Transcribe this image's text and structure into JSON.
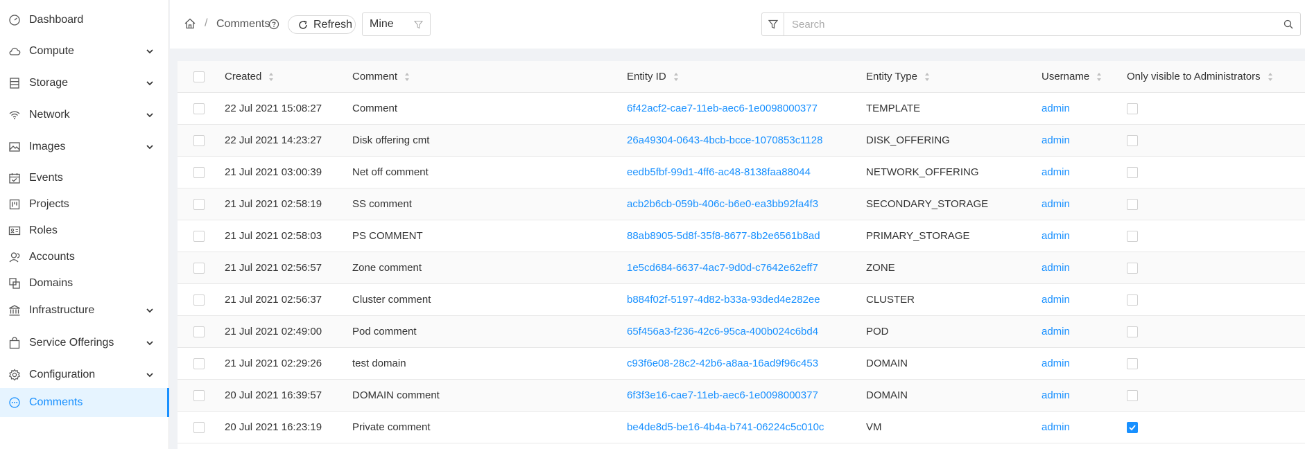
{
  "sidebar": {
    "items": [
      {
        "label": "Dashboard",
        "icon": "dashboard-icon",
        "expandable": false
      },
      {
        "label": "Compute",
        "icon": "cloud-icon",
        "expandable": true
      },
      {
        "label": "Storage",
        "icon": "storage-icon",
        "expandable": true
      },
      {
        "label": "Network",
        "icon": "wifi-icon",
        "expandable": true
      },
      {
        "label": "Images",
        "icon": "picture-icon",
        "expandable": true
      },
      {
        "label": "Events",
        "icon": "schedule-icon",
        "expandable": false
      },
      {
        "label": "Projects",
        "icon": "project-icon",
        "expandable": false
      },
      {
        "label": "Roles",
        "icon": "idcard-icon",
        "expandable": false
      },
      {
        "label": "Accounts",
        "icon": "team-icon",
        "expandable": false
      },
      {
        "label": "Domains",
        "icon": "block-icon",
        "expandable": false
      },
      {
        "label": "Infrastructure",
        "icon": "bank-icon",
        "expandable": true
      },
      {
        "label": "Service Offerings",
        "icon": "shopping-icon",
        "expandable": true
      },
      {
        "label": "Configuration",
        "icon": "setting-icon",
        "expandable": true
      },
      {
        "label": "Comments",
        "icon": "message-icon",
        "expandable": false,
        "active": true
      }
    ]
  },
  "toolbar": {
    "breadcrumb_separator": "/",
    "title": "Comments",
    "refresh_label": "Refresh",
    "filter_value": "Mine",
    "search_placeholder": "Search"
  },
  "table": {
    "columns": [
      "Created",
      "Comment",
      "Entity ID",
      "Entity Type",
      "Username",
      "Only visible to Administrators"
    ],
    "rows": [
      {
        "created": "22 Jul 2021 15:08:27",
        "comment": "Comment",
        "entity_id": "6f42acf2-cae7-11eb-aec6-1e0098000377",
        "entity_type": "TEMPLATE",
        "username": "admin",
        "admin_only": false
      },
      {
        "created": "22 Jul 2021 14:23:27",
        "comment": "Disk offering cmt",
        "entity_id": "26a49304-0643-4bcb-bcce-1070853c1128",
        "entity_type": "DISK_OFFERING",
        "username": "admin",
        "admin_only": false
      },
      {
        "created": "21 Jul 2021 03:00:39",
        "comment": "Net off comment",
        "entity_id": "eedb5fbf-99d1-4ff6-ac48-8138faa88044",
        "entity_type": "NETWORK_OFFERING",
        "username": "admin",
        "admin_only": false
      },
      {
        "created": "21 Jul 2021 02:58:19",
        "comment": "SS comment",
        "entity_id": "acb2b6cb-059b-406c-b6e0-ea3bb92fa4f3",
        "entity_type": "SECONDARY_STORAGE",
        "username": "admin",
        "admin_only": false
      },
      {
        "created": "21 Jul 2021 02:58:03",
        "comment": "PS COMMENT",
        "entity_id": "88ab8905-5d8f-35f8-8677-8b2e6561b8ad",
        "entity_type": "PRIMARY_STORAGE",
        "username": "admin",
        "admin_only": false
      },
      {
        "created": "21 Jul 2021 02:56:57",
        "comment": "Zone comment",
        "entity_id": "1e5cd684-6637-4ac7-9d0d-c7642e62eff7",
        "entity_type": "ZONE",
        "username": "admin",
        "admin_only": false
      },
      {
        "created": "21 Jul 2021 02:56:37",
        "comment": "Cluster comment",
        "entity_id": "b884f02f-5197-4d82-b33a-93ded4e282ee",
        "entity_type": "CLUSTER",
        "username": "admin",
        "admin_only": false
      },
      {
        "created": "21 Jul 2021 02:49:00",
        "comment": "Pod comment",
        "entity_id": "65f456a3-f236-42c6-95ca-400b024c6bd4",
        "entity_type": "POD",
        "username": "admin",
        "admin_only": false
      },
      {
        "created": "21 Jul 2021 02:29:26",
        "comment": "test domain",
        "entity_id": "c93f6e08-28c2-42b6-a8aa-16ad9f96c453",
        "entity_type": "DOMAIN",
        "username": "admin",
        "admin_only": false
      },
      {
        "created": "20 Jul 2021 16:39:57",
        "comment": "DOMAIN comment",
        "entity_id": "6f3f3e16-cae7-11eb-aec6-1e0098000377",
        "entity_type": "DOMAIN",
        "username": "admin",
        "admin_only": false
      },
      {
        "created": "20 Jul 2021 16:23:19",
        "comment": "Private comment",
        "entity_id": "be4de8d5-be16-4b4a-b741-06224c5c010c",
        "entity_type": "VM",
        "username": "admin",
        "admin_only": true
      }
    ]
  },
  "colors": {
    "accent": "#1890ff",
    "border": "#e8e8e8"
  }
}
